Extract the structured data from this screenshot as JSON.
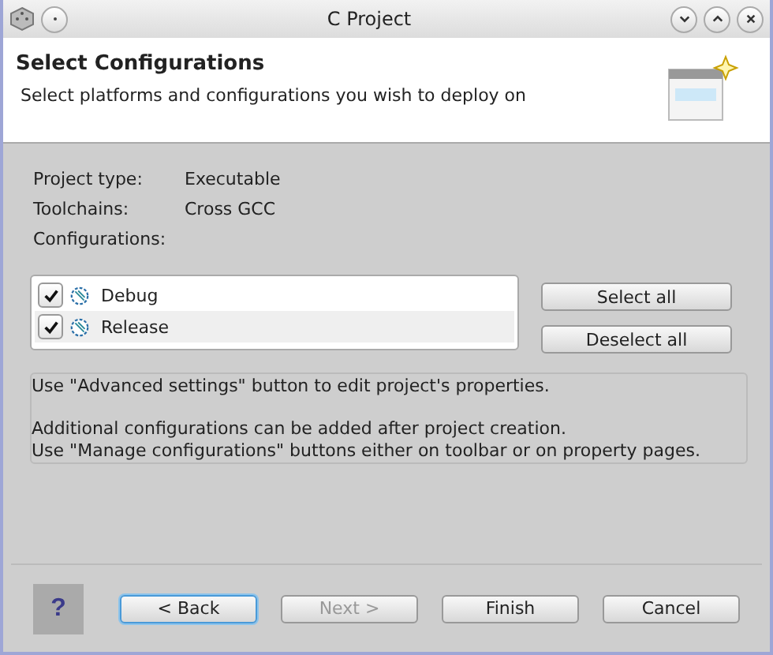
{
  "window": {
    "title": "C Project"
  },
  "header": {
    "title": "Select Configurations",
    "subtitle": "Select platforms and configurations you wish to deploy on"
  },
  "info": [
    {
      "label": "Project type:",
      "value": "Executable"
    },
    {
      "label": "Toolchains:",
      "value": "Cross GCC"
    },
    {
      "label": "Configurations:"
    }
  ],
  "configurations": [
    {
      "name": "Debug",
      "checked": true,
      "selected": false
    },
    {
      "name": "Release",
      "checked": true,
      "selected": true
    }
  ],
  "side_buttons": [
    "Select all",
    "Deselect all"
  ],
  "message_paragraphs": [
    [
      "Use \"Advanced settings\" button to edit project's properties."
    ],
    [
      "Additional configurations can be added after project creation.",
      "Use \"Manage configurations\" buttons either on toolbar or on property pages."
    ]
  ],
  "help": {
    "label": "?"
  },
  "buttons": [
    {
      "label": "< Back",
      "disabled": false,
      "focused": true
    },
    {
      "label": "Next >",
      "disabled": true,
      "focused": false
    },
    {
      "label": "Finish",
      "disabled": false,
      "focused": false
    },
    {
      "label": "Cancel",
      "disabled": false,
      "focused": false
    }
  ]
}
